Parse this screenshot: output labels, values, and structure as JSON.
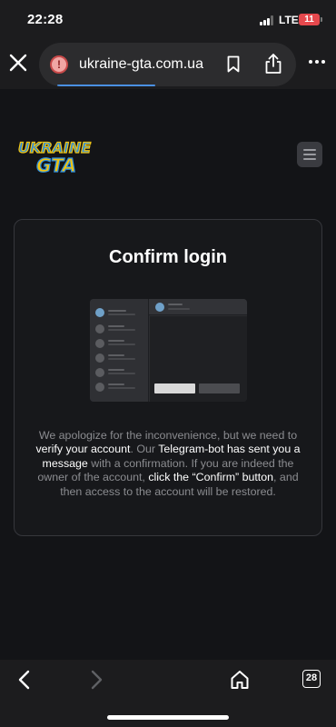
{
  "status_bar": {
    "time": "22:28",
    "network": "LTE",
    "battery": "11",
    "battery_color": "#e5484d"
  },
  "browser": {
    "url": "ukraine-gta.com.ua",
    "security_icon": "warning-icon",
    "tab_count": "28",
    "accent_color": "#4a90e2"
  },
  "site": {
    "logo_line1": "UKRAINE",
    "logo_line2": "GTA"
  },
  "card": {
    "title": "Confirm login",
    "message": {
      "p1": "We apologize for the inconvenience, but we need to ",
      "h1": "verify your account",
      "p2": ". Our ",
      "h2": "Telegram-bot has sent you a message",
      "p3": " with a confirmation. If you are indeed the owner of the account, ",
      "h3": "click the “Confirm” button",
      "p4": ", and then access to the account will be restored."
    }
  }
}
